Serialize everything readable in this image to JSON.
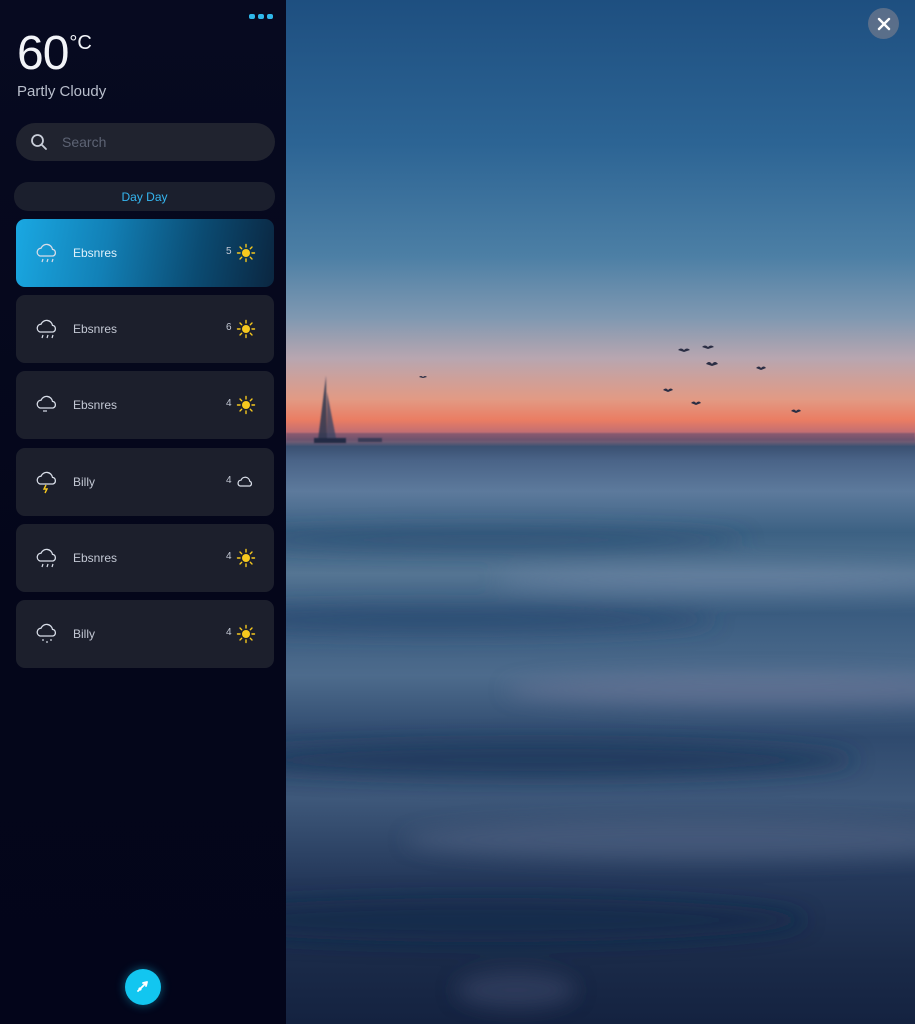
{
  "weather": {
    "temperature": "60",
    "unit": "°C",
    "condition": "Partly Cloudy"
  },
  "search": {
    "placeholder": "Search",
    "icon": "search-icon"
  },
  "filter": {
    "label": "Day Day"
  },
  "forecast": [
    {
      "label": "Ebsnres",
      "icon": "cloud-rain-icon",
      "right_text": "5",
      "right_icon": "sun-icon",
      "active": true
    },
    {
      "label": "Ebsnres",
      "icon": "cloud-rain-icon",
      "right_text": "6",
      "right_icon": "sun-icon",
      "active": false
    },
    {
      "label": "Ebsnres",
      "icon": "cloud-icon",
      "right_text": "4",
      "right_icon": "sun-icon",
      "active": false
    },
    {
      "label": "Billy",
      "icon": "cloud-lightning-icon",
      "right_text": "4",
      "right_icon": "cloud-icon",
      "active": false
    },
    {
      "label": "Ebsnres",
      "icon": "cloud-rain-icon",
      "right_text": "4",
      "right_icon": "sun-icon",
      "active": false
    },
    {
      "label": "Billy",
      "icon": "cloud-drizzle-icon",
      "right_text": "4",
      "right_icon": "sun-icon",
      "active": false
    }
  ],
  "colors": {
    "accent": "#12c6f0",
    "sidebar_bg": "#05071a",
    "card_bg": "#1c1f2c",
    "sun": "#f6c81e"
  },
  "icons": {
    "menu": "more-dots-icon",
    "close": "close-icon",
    "fab": "location-icon"
  }
}
